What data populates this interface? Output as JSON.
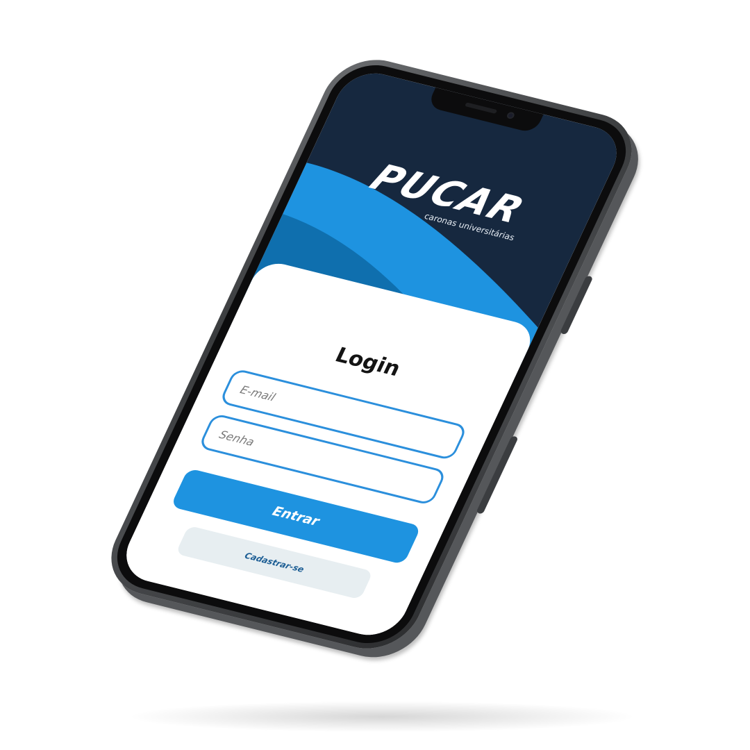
{
  "app": {
    "logo_text": "PUCAR",
    "tagline": "caronas universitárias"
  },
  "login": {
    "title": "Login",
    "email_placeholder": "E-mail",
    "email_value": "",
    "password_placeholder": "Senha",
    "password_value": "",
    "submit_label": "Entrar",
    "signup_label": "Cadastrar-se"
  },
  "theme": {
    "header_bg": "#16283f",
    "accent": "#1e93e0",
    "wave_dark": "#0f6fae",
    "field_border": "#2b8fdc",
    "secondary_button_bg": "#e7eef1",
    "secondary_button_text": "#1e5f95",
    "phone_frame": "#4a4c4f"
  },
  "icons": {
    "speaker": "speaker-grille-icon",
    "camera": "front-camera-icon"
  }
}
